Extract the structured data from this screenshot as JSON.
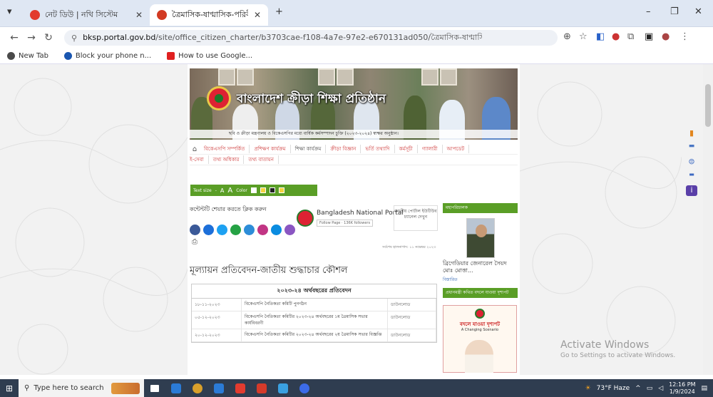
{
  "browser": {
    "tabs": [
      {
        "title": "নেট ডিউ | নথি সিস্টেম",
        "active": false,
        "favicon_color": "#e23b2f"
      },
      {
        "title": "ত্রৈমাসিক-ষাণ্মাসিক-পরিবীক্ষণ-মূ",
        "active": true,
        "favicon_color": "#d23a22"
      }
    ],
    "new_tab_glyph": "+",
    "window_controls": [
      "–",
      "❐",
      "✕"
    ]
  },
  "toolbar": {
    "url_host": "bksp.portal.gov.bd",
    "url_path": "/site/office_citizen_charter/b3703cae-f108-4a7e-97e2-e670131ad050/ত্রৈমাসিক-ষাণ্মাসিক-পরিবীক্ষণ-মূল্যায়ন-প্রতিবেদন"
  },
  "bookmarks": [
    {
      "label": "New Tab",
      "color": "#4a4a4a"
    },
    {
      "label": "Block your phone n...",
      "color": "#1a56b0"
    },
    {
      "label": "How to use Google...",
      "color": "#e02020"
    }
  ],
  "site": {
    "banner_title": "বাংলাদেশ ক্রীড়া শিক্ষা প্রতিষ্ঠান",
    "banner_ticker": "ছবি ও ক্রীড়া মন্ত্রণালয় ও বিকেএসপির মধ্যে বার্ষিক কর্মসম্পাদন চুক্তি (২০২৩-২০২৪) স্বাক্ষর অনুষ্ঠান।",
    "menu_row1": [
      "বিকেএসপি সম্পর্কিত",
      "প্রশিক্ষণ কার্যক্রম",
      "শিক্ষা কার্যক্রম",
      "ক্রীড়া বিজ্ঞান",
      "ভর্তি তথ্যাদি",
      "কর্মসূচী",
      "গ্যালারী",
      "আপডেট"
    ],
    "menu_row2": [
      "ই-সেবা",
      "তথ্য অধিকার",
      "তথ্য বাতায়ন"
    ],
    "text_size_label": "Text size",
    "text_size_options": [
      "-",
      "A",
      "A"
    ],
    "color_label": "Color",
    "color_swatches": [
      "#ffffff",
      "#f5d33f",
      "#222222",
      "#f5d33f"
    ],
    "share_title": "কন্টেন্টটি শেয়ার করতে ক্লিক করুন",
    "share_colors": [
      "#3b5998",
      "#1d6fd9",
      "#1da1f2",
      "#25a244",
      "#2d8dd8",
      "#c13584",
      "#0a8ce0",
      "#8a56c2"
    ],
    "national_portal": {
      "name": "Bangladesh National Portal",
      "fb_button": "Follow Page",
      "fb_count": "136K followers"
    },
    "portal_side": "জাতীয় পোর্টাল ইউটিউব চ্যানেল দেখুন",
    "last_updated": "সর্বশেষ হালনাগাদ: ১১ নভেম্বর ২০২৩",
    "doc_title": "মূল্যায়ন প্রতিবেদন-জাতীয় শুদ্ধাচার কৌশল",
    "report_heading": "২০২৩-২৪ অর্থবছরের প্রতিবেদন",
    "report_rows": [
      {
        "date": "১৮-১১-২০২৩",
        "title": "বিকেএসপি নৈতিকতা কমিটি পুনর্গঠন",
        "link": "ডাউনলোড"
      },
      {
        "date": "০৫-১২-২০২৩",
        "title": "বিকেএসপি নৈতিকতা কমিটির ২০২৩-২৪ অর্থবছরের ১ম ত্রৈমাসিক সভার কার্যবিবরণী",
        "link": "ডাউনলোড"
      },
      {
        "date": "২০-১২-২০২৩",
        "title": "বিকেএসপি নৈতিকতা কমিটির ২০২৩-২৪ অর্থবছরের ২য় ত্রৈমাসিক সভার বিজ্ঞপ্তি",
        "link": "ডাউনলোড"
      }
    ],
    "sidebar_bar1": "মহাপরিচালক",
    "officer_name": "ব্রিগেডিয়ার জেনারেল সৈয়দ মোঃ মোত্তা...",
    "officer_role": "বিস্তারিত",
    "sidebar_bar2": "প্রধানমন্ত্রী কথিত বদলে যাওয়া দৃশ্যপট",
    "poster_title": "বদলে যাওয়া দৃশ্যপট",
    "poster_sub": "A Changing Scenario"
  },
  "watermark": {
    "title": "Activate Windows",
    "sub": "Go to Settings to activate Windows."
  },
  "taskbar": {
    "search_placeholder": "Type here to search",
    "weather": "73°F Haze",
    "time": "12:16 PM",
    "date": "1/9/2024",
    "app_colors": [
      "#ffffff",
      "#2b7bd6",
      "#d9a02b",
      "#2b7bd6",
      "#e23b2f",
      "#d43a2a",
      "#3aa0e0",
      "#3c6be8"
    ]
  }
}
